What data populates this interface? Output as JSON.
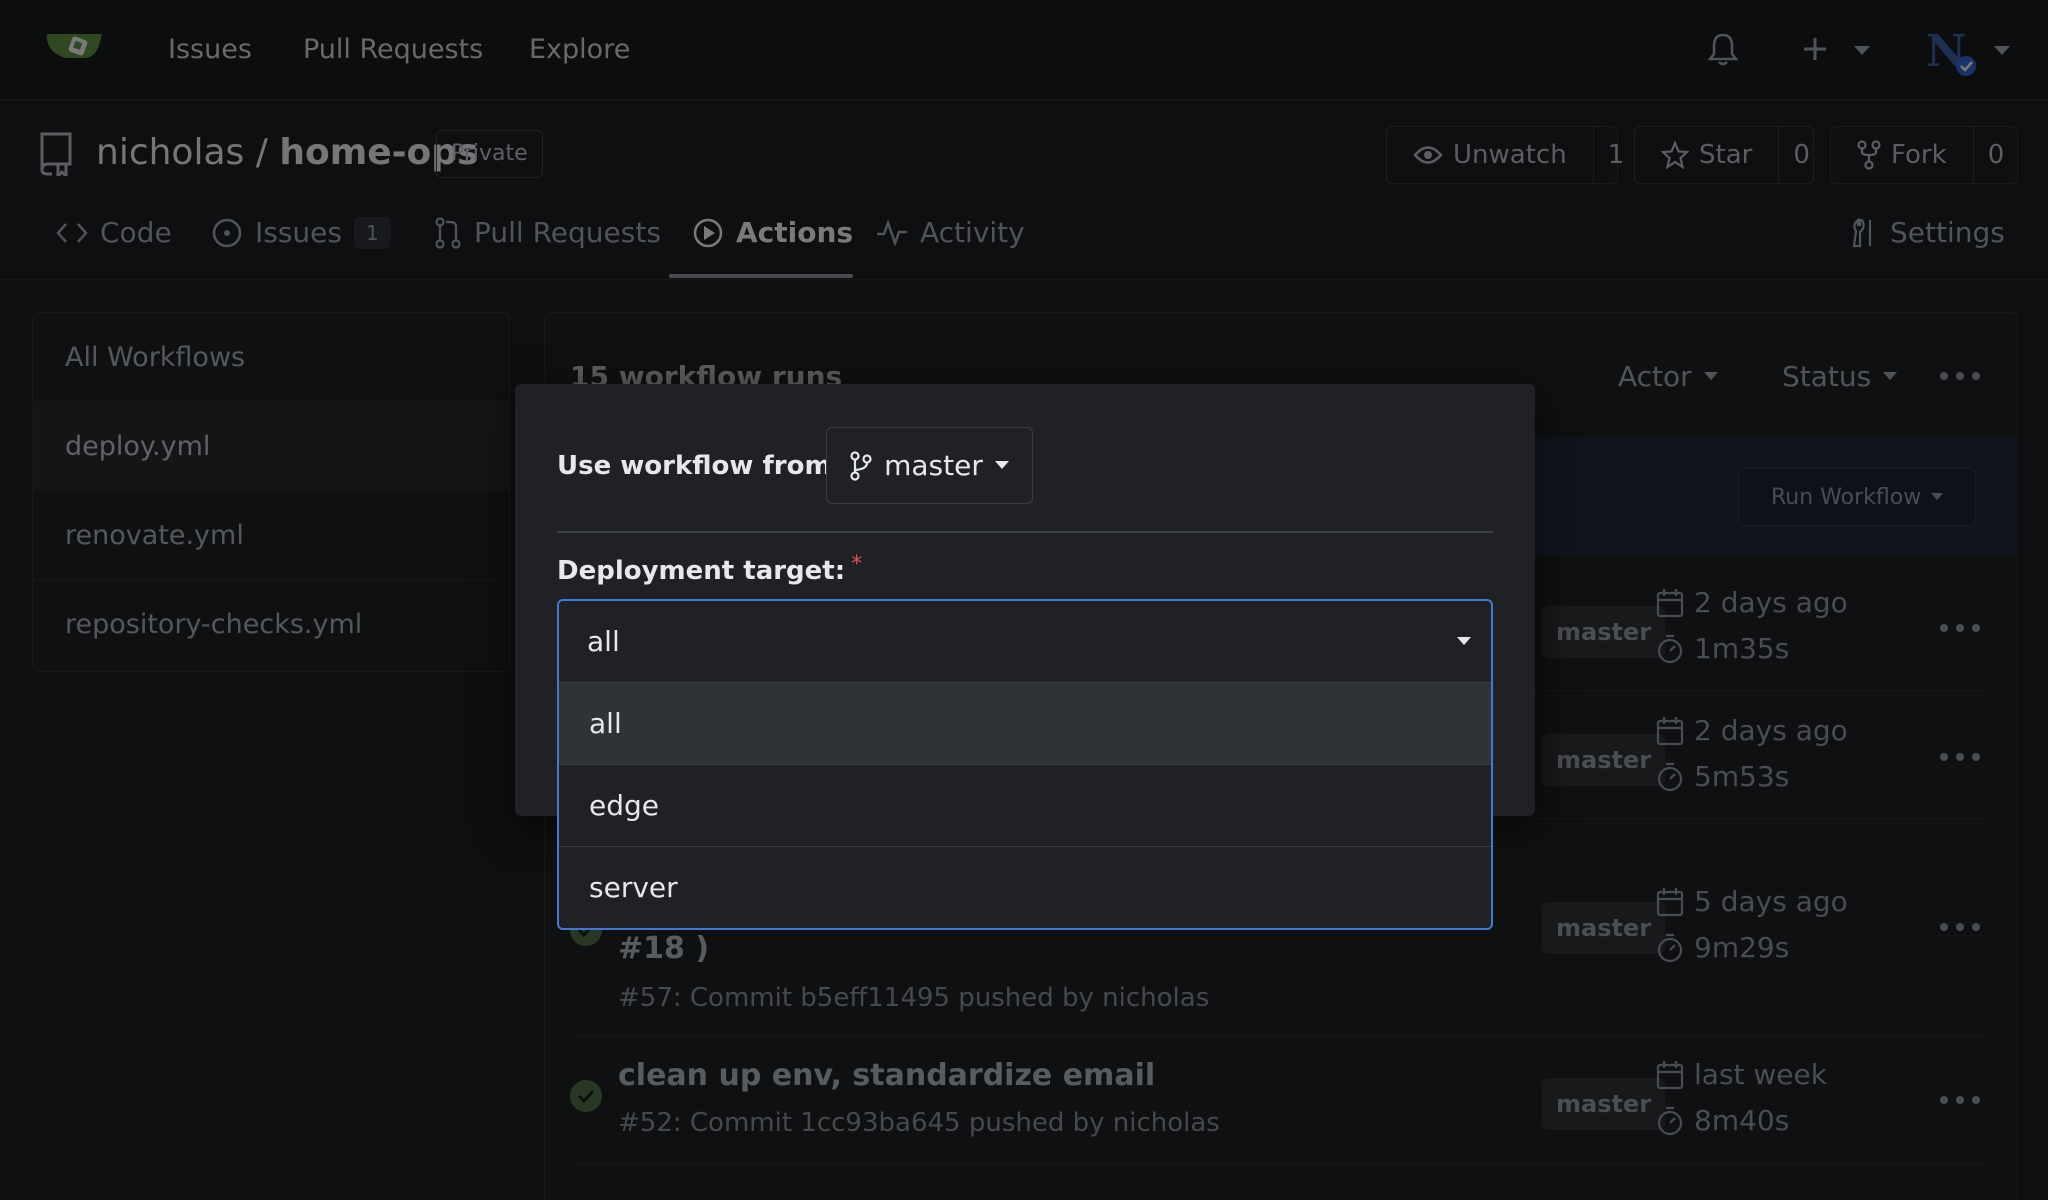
{
  "topnav": {
    "links": [
      "Issues",
      "Pull Requests",
      "Explore"
    ]
  },
  "repo": {
    "owner": "nicholas",
    "separator": "/",
    "name": "home-ops",
    "visibility": "Private",
    "watch": {
      "label": "Unwatch",
      "count": "1"
    },
    "star": {
      "label": "Star",
      "count": "0"
    },
    "fork": {
      "label": "Fork",
      "count": "0"
    }
  },
  "tabs": [
    {
      "label": "Code"
    },
    {
      "label": "Issues",
      "count": "1"
    },
    {
      "label": "Pull Requests"
    },
    {
      "label": "Actions"
    },
    {
      "label": "Activity"
    },
    {
      "label": "Settings"
    }
  ],
  "sidebar": {
    "items": [
      "All Workflows",
      "deploy.yml",
      "renovate.yml",
      "repository-checks.yml"
    ]
  },
  "main": {
    "runs_count": "15 workflow runs",
    "filters": {
      "actor": "Actor",
      "status": "Status"
    },
    "run_workflow_label": "Run Workflow",
    "runs": [
      {
        "title": "",
        "sub": "",
        "branch": "master",
        "date": "2 days ago",
        "duration": "1m35s"
      },
      {
        "title": "",
        "sub": "",
        "branch": "master",
        "date": "2 days ago",
        "duration": "5m53s"
      },
      {
        "title": "#18 )",
        "sub": "#57: Commit b5eff11495 pushed by nicholas",
        "branch": "master",
        "date": "5 days ago",
        "duration": "9m29s"
      },
      {
        "title": "clean up env, standardize email",
        "sub": "#52: Commit 1cc93ba645 pushed by nicholas",
        "branch": "master",
        "date": "last week",
        "duration": "8m40s"
      }
    ]
  },
  "modal": {
    "use_workflow_label": "Use workflow from:",
    "required_mark": "*",
    "branch": "master",
    "target_label": "Deployment target:",
    "target_value": "all",
    "options": [
      "all",
      "edge",
      "server"
    ]
  },
  "colors": {
    "accent_focus": "#3d7ad6",
    "required": "#e05252",
    "success": "#4f6b45"
  }
}
